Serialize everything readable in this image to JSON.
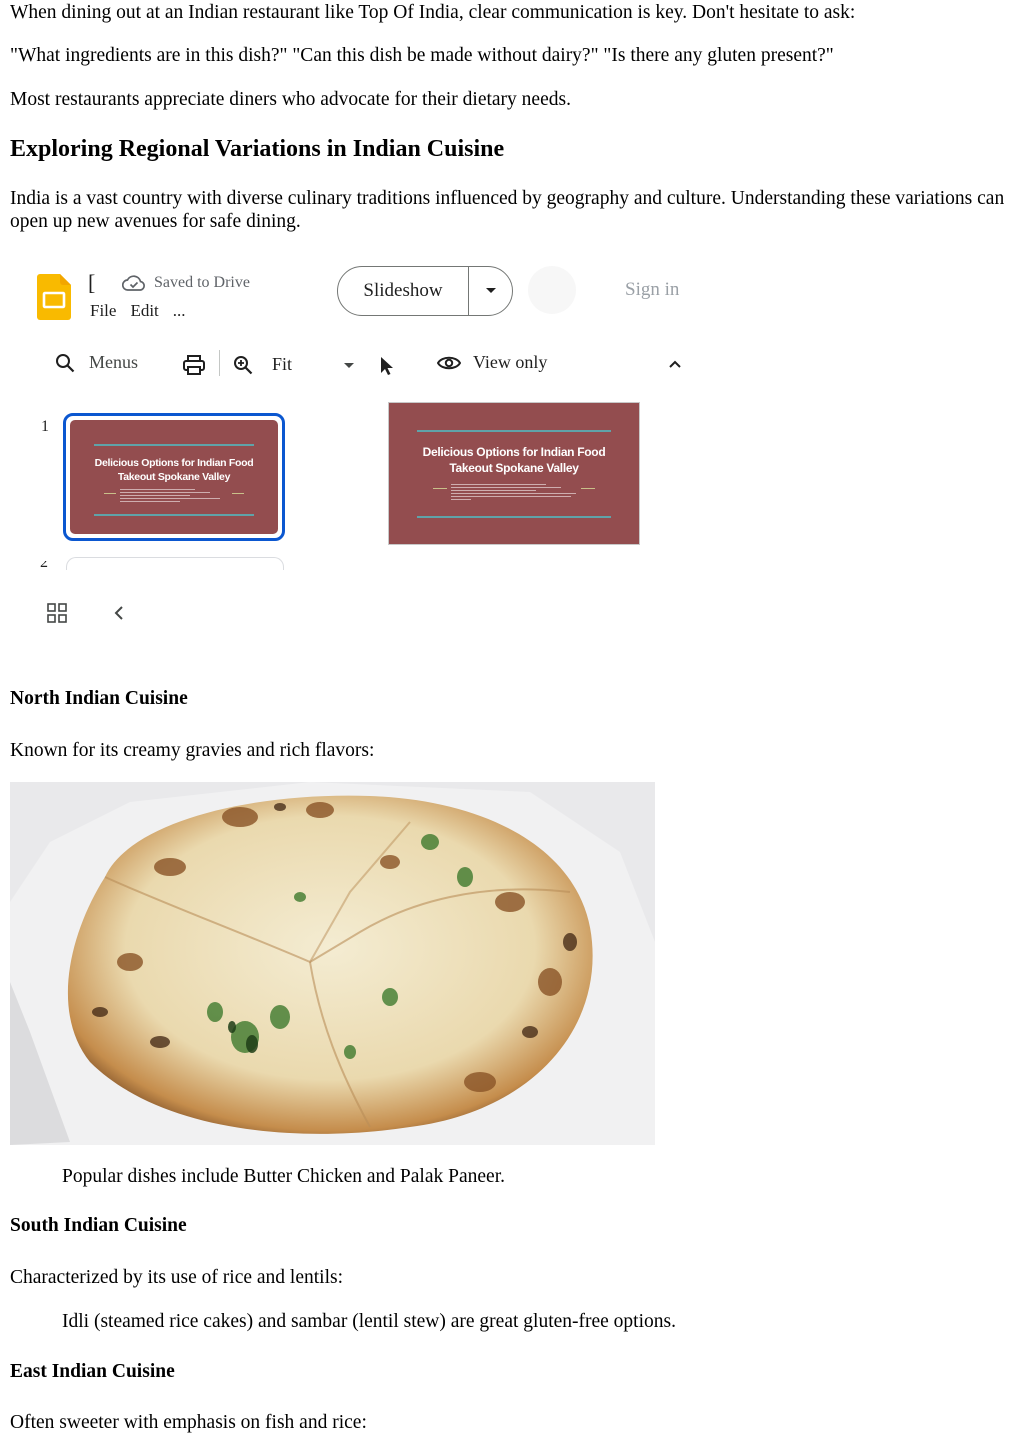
{
  "article": {
    "p1": "When dining out at an Indian restaurant like Top Of India, clear communication is key. Don't hesitate to ask:",
    "p2": "\"What ingredients are in this dish?\" \"Can this dish be made without dairy?\" \"Is there any gluten present?\"",
    "p3": "Most restaurants appreciate diners who advocate for their dietary needs.",
    "h_regional": "Exploring Regional Variations in Indian Cuisine",
    "p4": "India is a vast country with diverse culinary traditions influenced by geography and culture. Understanding these variations can open up new avenues for safe dining.",
    "h_north": "North Indian Cuisine",
    "p_north": "Known for its creamy gravies and rich flavors:",
    "p_north_dishes": "Popular dishes include Butter Chicken and Palak Paneer.",
    "h_south": "South Indian Cuisine",
    "p_south": "Characterized by its use of rice and lentils:",
    "p_south_dishes": "Idli (steamed rice cakes) and sambar (lentil stew) are great gluten-free options.",
    "h_east": "East Indian Cuisine",
    "p_east": "Often sweeter with emphasis on fish and rice:"
  },
  "viewer": {
    "doc_title": "[",
    "saved_status": "Saved to Drive",
    "menus": [
      "File",
      "Edit",
      "..."
    ],
    "slideshow_label": "Slideshow",
    "signin_label": "Sign in",
    "toolbar": {
      "menus_label": "Menus",
      "zoom_label": "Fit",
      "view_mode_label": "View only"
    },
    "thumbnail_number": "1",
    "next_thumbnail_number": "2",
    "slide_title_line1": "Delicious Options for Indian Food",
    "slide_title_line2": "Takeout Spokane Valley",
    "colors": {
      "slide_bg": "#934d4f",
      "accent_line": "#5fa3a9",
      "selected_border": "#0b57d0",
      "logo_yellow": "#f9ba00"
    }
  },
  "icons": [
    "slides-logo-icon",
    "cloud-check-icon",
    "dropdown-arrow-icon",
    "search-icon",
    "print-icon",
    "zoom-in-icon",
    "pointer-icon",
    "eye-icon",
    "chevron-up-icon",
    "grid-view-icon",
    "chevron-left-icon"
  ]
}
